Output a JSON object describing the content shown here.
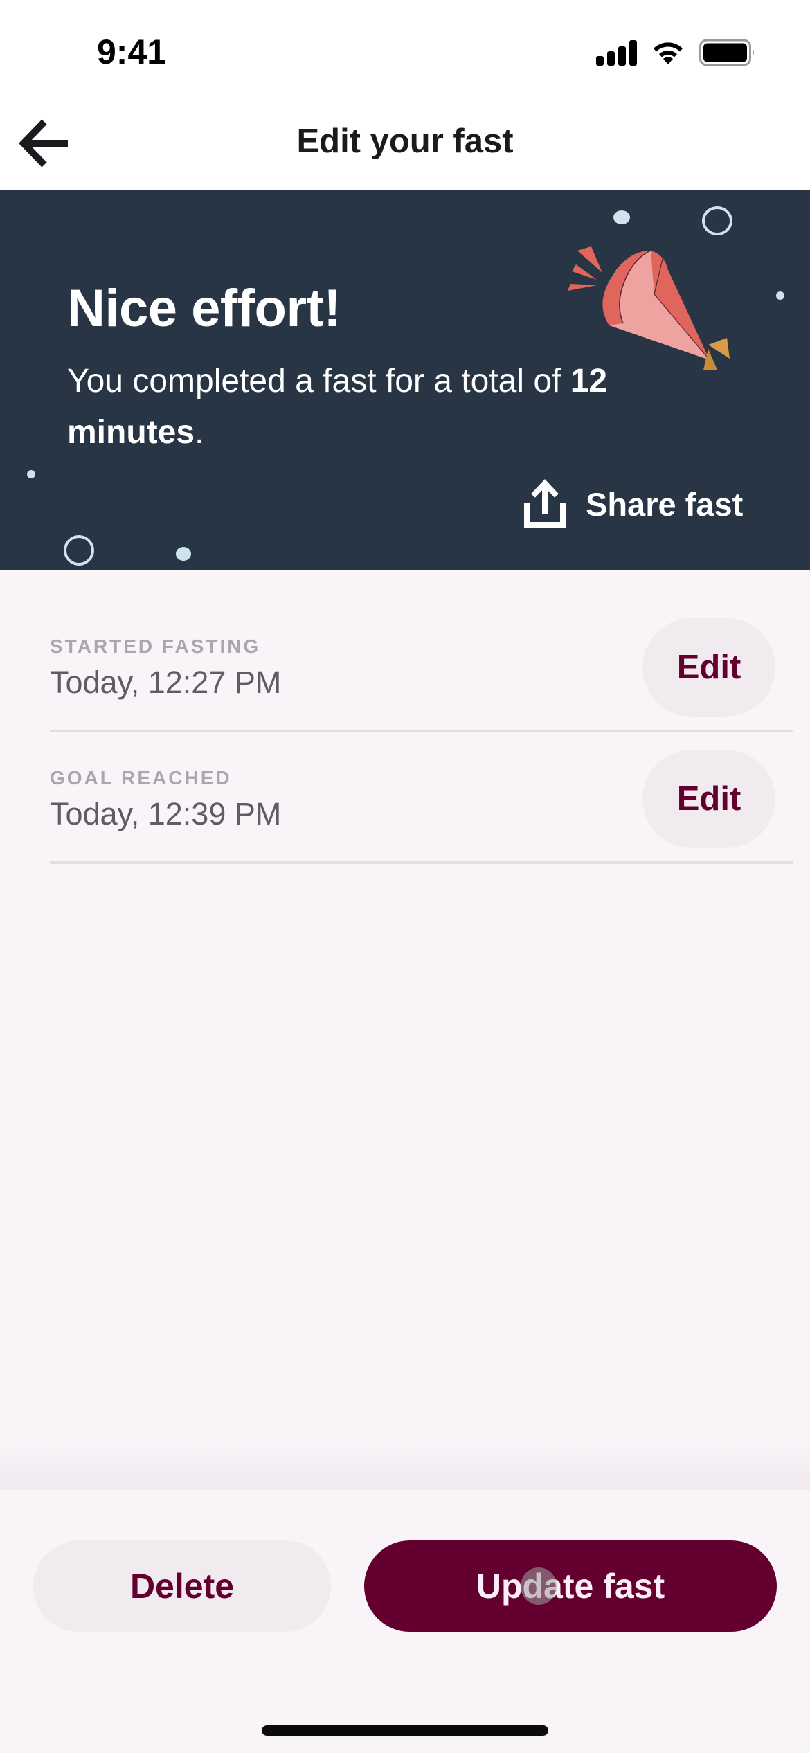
{
  "status_bar": {
    "time": "9:41",
    "icons": [
      "signal-icon",
      "wifi-icon",
      "battery-icon"
    ]
  },
  "header": {
    "back_icon": "arrow-left-icon",
    "title": "Edit your fast"
  },
  "banner": {
    "title": "Nice effort!",
    "body_prefix": "You completed a fast for a total of ",
    "body_bold": "12 minutes",
    "body_suffix": ".",
    "share_label": "Share fast",
    "share_icon": "share-icon",
    "illustration": "party-popper-icon",
    "colors": {
      "background": "#283545",
      "confetti": "#cfe3ee",
      "popper_main": "#e0655d",
      "popper_light": "#eea3a0",
      "popper_tip": "#d99a48"
    }
  },
  "events": [
    {
      "label": "STARTED FASTING",
      "value": "Today, 12:27 PM",
      "edit_label": "Edit"
    },
    {
      "label": "GOAL REACHED",
      "value": "Today, 12:39 PM",
      "edit_label": "Edit"
    }
  ],
  "actions": {
    "delete_label": "Delete",
    "update_label": "Update fast"
  },
  "theme": {
    "accent": "#63002f",
    "page_background": "#f9f4f8",
    "secondary_button": "#f1ebf0",
    "label_gray": "#aca6ac",
    "value_gray": "#615c62"
  }
}
